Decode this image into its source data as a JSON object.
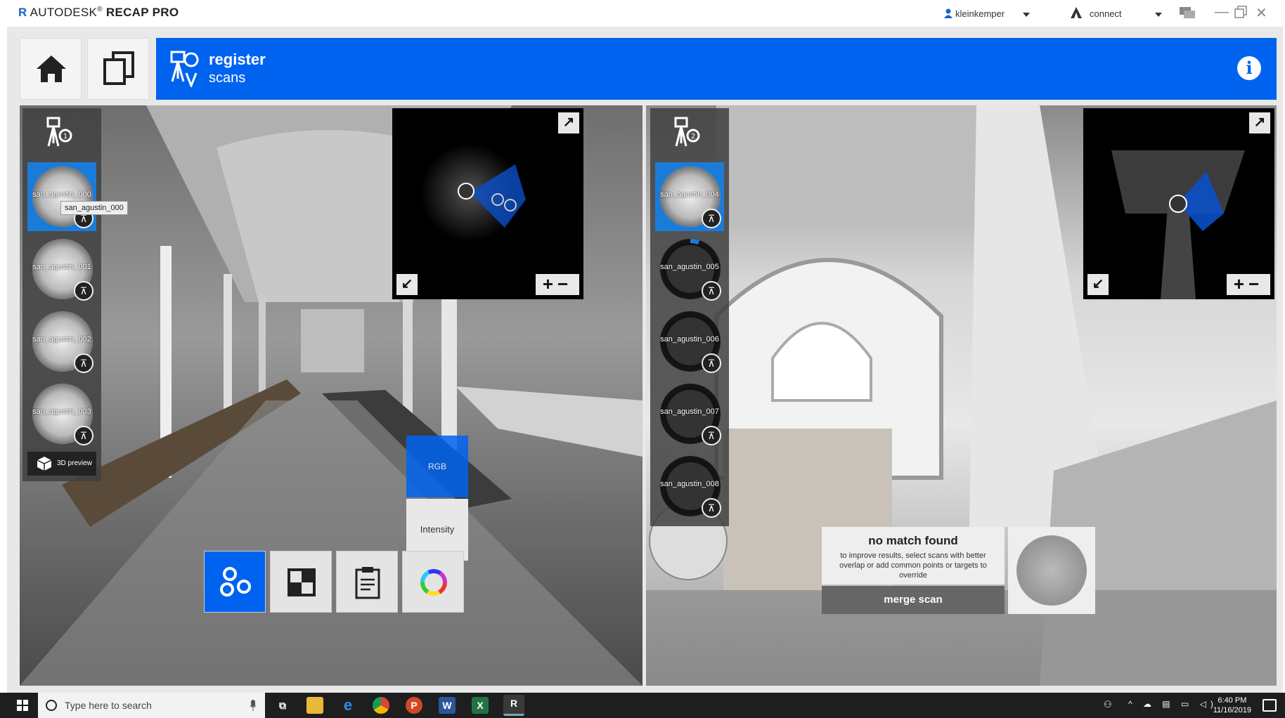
{
  "app": {
    "logo_letter": "R",
    "title_plain": "AUTODESK",
    "title_bold": "RECAP PRO"
  },
  "titlebar": {
    "user": "kleinkemper",
    "connect": "connect"
  },
  "header": {
    "title": "register",
    "subtitle": "scans"
  },
  "left_panel": {
    "scans": [
      {
        "name": "san_agustin_000",
        "selected": true,
        "captured": true
      },
      {
        "name": "san_agustin_001",
        "selected": false,
        "captured": true
      },
      {
        "name": "san_agustin_002",
        "selected": false,
        "captured": true
      },
      {
        "name": "san_agustin_003",
        "selected": false,
        "captured": true
      }
    ],
    "tooltip": "san_agustin_000",
    "preview_label": "3D preview"
  },
  "right_panel": {
    "scans": [
      {
        "name": "san_agustin_004",
        "selected": true,
        "captured": true
      },
      {
        "name": "san_agustin_005",
        "selected": false,
        "captured": false
      },
      {
        "name": "san_agustin_006",
        "selected": false,
        "captured": false
      },
      {
        "name": "san_agustin_007",
        "selected": false,
        "captured": false
      },
      {
        "name": "san_agustin_008",
        "selected": false,
        "captured": false
      }
    ]
  },
  "color_modes": {
    "rgb": "RGB",
    "intensity": "Intensity"
  },
  "match": {
    "title": "no match found",
    "description": "to improve results, select scans with better overlap or add common points or targets to override",
    "merge_label": "merge scan"
  },
  "taskbar": {
    "search_placeholder": "Type here to search",
    "time": "6:40 PM",
    "date": "11/16/2019"
  },
  "colors": {
    "accent": "#0063f0",
    "selected_scan": "#1b7cd8",
    "taskbar": "#1e1e1e"
  },
  "icons": [
    "home-icon",
    "pages-icon",
    "register-icon",
    "info-icon",
    "expand-icon",
    "collapse-icon",
    "zoom-in-icon",
    "zoom-out-icon",
    "scan-target-icon",
    "cube-icon",
    "color-wheel-icon",
    "windows-icon"
  ]
}
